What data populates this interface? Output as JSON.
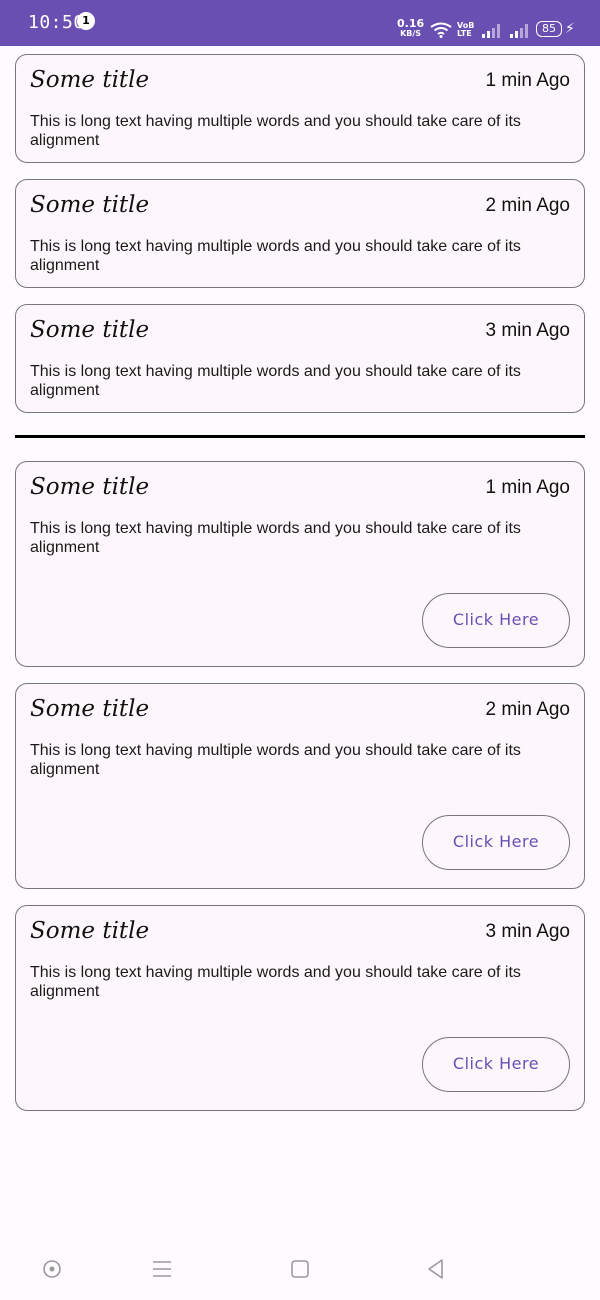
{
  "status_bar": {
    "time": "10:50",
    "notification_count": "1",
    "net_speed_value": "0.16",
    "net_speed_unit": "KB/S",
    "volte_line1": "VoB",
    "volte_line2": "LTE",
    "battery_level": "85"
  },
  "section_a": {
    "cards": [
      {
        "title": "Some title",
        "time": "1 min Ago",
        "body": "This is long text having multiple words and you should take care of its alignment"
      },
      {
        "title": "Some title",
        "time": "2 min Ago",
        "body": "This is long text having multiple words and you should take care of its alignment"
      },
      {
        "title": "Some title",
        "time": "3 min Ago",
        "body": "This is long text having multiple words and you should take care of its alignment"
      }
    ]
  },
  "section_b": {
    "cards": [
      {
        "title": "Some title",
        "time": "1 min Ago",
        "body": "This is long text having multiple words and you should take care of its alignment",
        "button": "Click Here"
      },
      {
        "title": "Some title",
        "time": "2 min Ago",
        "body": "This is long text having multiple words and you should take care of its alignment",
        "button": "Click Here"
      },
      {
        "title": "Some title",
        "time": "3 min Ago",
        "body": "This is long text having multiple words and you should take care of its alignment",
        "button": "Click Here"
      }
    ]
  },
  "colors": {
    "status_bar": "#6a4fb3",
    "card_border": "#79747e",
    "button_text": "#6a4fb3",
    "background": "#fefbfe"
  },
  "icons": [
    "wifi-icon",
    "signal-icon",
    "battery-icon",
    "charging-icon",
    "nav-assistant-icon",
    "nav-recents-icon",
    "nav-home-icon",
    "nav-back-icon"
  ]
}
